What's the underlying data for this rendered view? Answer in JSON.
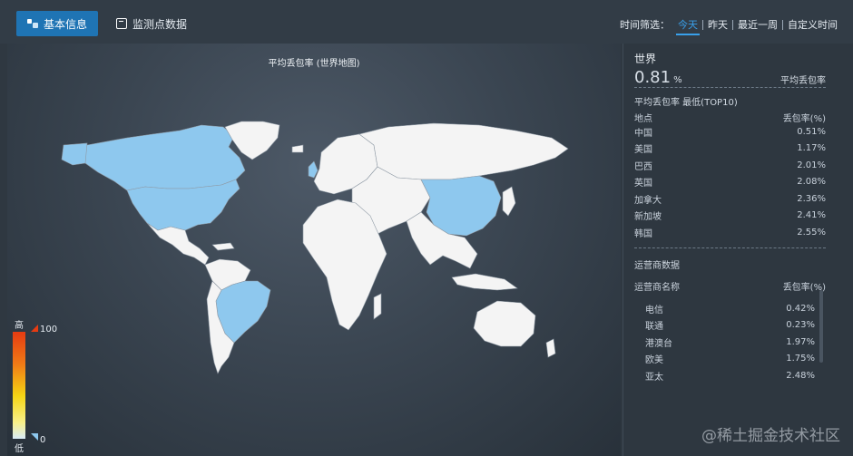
{
  "tabs": [
    {
      "label": "基本信息",
      "active": true
    },
    {
      "label": "监测点数据",
      "active": false
    }
  ],
  "time_filter": {
    "label": "时间筛选：",
    "options": [
      "今天",
      "昨天",
      "最近一周",
      "自定义时间"
    ],
    "selected": "今天"
  },
  "map": {
    "title": "平均丢包率 (世界地图)",
    "highlighted_countries": [
      "中国",
      "美国",
      "巴西",
      "英国",
      "加拿大"
    ],
    "highlight_color": "#8ec8ee",
    "land_color": "#f4f4f4",
    "legend": {
      "high_label": "高",
      "low_label": "低",
      "max": "100",
      "min": "0"
    }
  },
  "side": {
    "region": "世界",
    "value": "0.81",
    "unit": "%",
    "value_label": "平均丢包率",
    "top_title": "平均丢包率 最低(TOP10)",
    "top_header": {
      "name": "地点",
      "value": "丢包率(%)"
    },
    "top_rows": [
      {
        "name": "中国",
        "value": "0.51%"
      },
      {
        "name": "美国",
        "value": "1.17%"
      },
      {
        "name": "巴西",
        "value": "2.01%"
      },
      {
        "name": "英国",
        "value": "2.08%"
      },
      {
        "name": "加拿大",
        "value": "2.36%"
      },
      {
        "name": "新加坡",
        "value": "2.41%"
      },
      {
        "name": "韩国",
        "value": "2.55%"
      }
    ],
    "op_title": "运营商数据",
    "op_header": {
      "name": "运营商名称",
      "value": "丢包率(%)"
    },
    "op_rows": [
      {
        "name": "电信",
        "value": "0.42%"
      },
      {
        "name": "联通",
        "value": "0.23%"
      },
      {
        "name": "港澳台",
        "value": "1.97%"
      },
      {
        "name": "欧美",
        "value": "1.75%"
      },
      {
        "name": "亚太",
        "value": "2.48%"
      }
    ]
  },
  "watermark": "@稀土掘金技术社区"
}
